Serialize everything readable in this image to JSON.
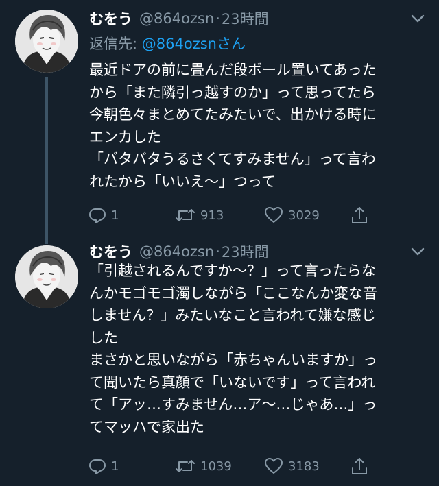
{
  "colors": {
    "background": "#15202b",
    "text_primary": "#ffffff",
    "text_secondary": "#8899a6",
    "link": "#1da1f2",
    "thread_line": "#3d5466"
  },
  "tweets": [
    {
      "display_name": "むをう",
      "handle": "@864ozsn",
      "separator": "·",
      "time": "23時間",
      "reply_to_prefix": "返信先: ",
      "reply_to_handle": "@864ozsnさん",
      "body_lines": [
        "最近ドアの前に畳んだ段ボール置いてあった",
        "から「また隣引っ越すのか」って思ってたら",
        "今朝色々まとめてたみたいで、出かける時に",
        "エンカした",
        "「バタバタうるさくてすみません」って言わ",
        "れたから「いいえ〜」つって"
      ],
      "replies": "1",
      "retweets": "913",
      "likes": "3029",
      "icons": [
        "reply-icon",
        "retweet-icon",
        "heart-icon",
        "share-icon",
        "caret-down-icon"
      ]
    },
    {
      "display_name": "むをう",
      "handle": "@864ozsn",
      "separator": "·",
      "time": "23時間",
      "body_lines": [
        "「引越されるんですか〜？」って言ったらな",
        "んかモゴモゴ濁しながら「ここなんか変な音",
        "しません？」みたいなこと言われて嫌な感じ",
        "した",
        "まさかと思いながら「赤ちゃんいますか」っ",
        "て聞いたら真顔で「いないです」って言われ",
        "て「アッ…すみません…ア〜…じゃあ…」っ",
        "てマッハで家出た"
      ],
      "replies": "1",
      "retweets": "1039",
      "likes": "3183",
      "icons": [
        "reply-icon",
        "retweet-icon",
        "heart-icon",
        "share-icon",
        "caret-down-icon"
      ]
    }
  ]
}
